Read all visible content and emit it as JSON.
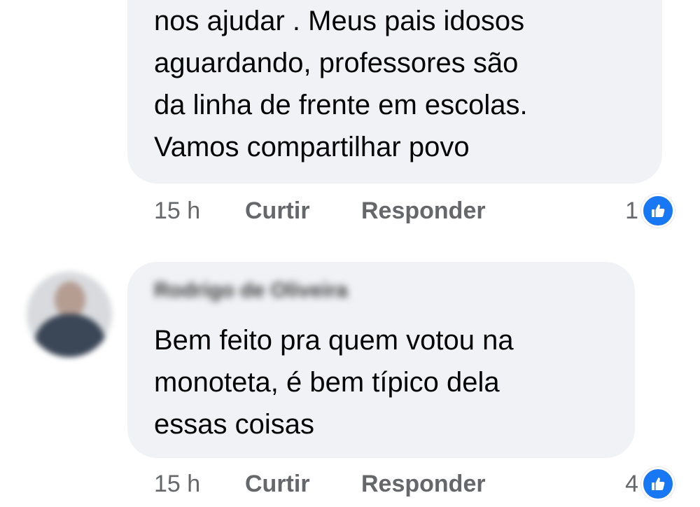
{
  "comments": [
    {
      "author": "",
      "text": "nos ajudar . Meus pais idosos\naguardando, professores são\nda linha de frente em escolas.\nVamos compartilhar povo",
      "time": "15 h",
      "like_label": "Curtir",
      "reply_label": "Responder",
      "reaction_count": "1",
      "reaction_icon": "thumbs-up-icon"
    },
    {
      "author": "Rodrigo de Oliveira",
      "text": "Bem feito pra quem votou na\nmonoteta, é bem típico dela\nessas coisas",
      "time": "15 h",
      "like_label": "Curtir",
      "reply_label": "Responder",
      "reaction_count": "4",
      "reaction_icon": "thumbs-up-icon"
    }
  ],
  "colors": {
    "bubble_bg": "#f0f2f5",
    "meta_text": "#65676b",
    "like_blue": "#1877f2"
  }
}
